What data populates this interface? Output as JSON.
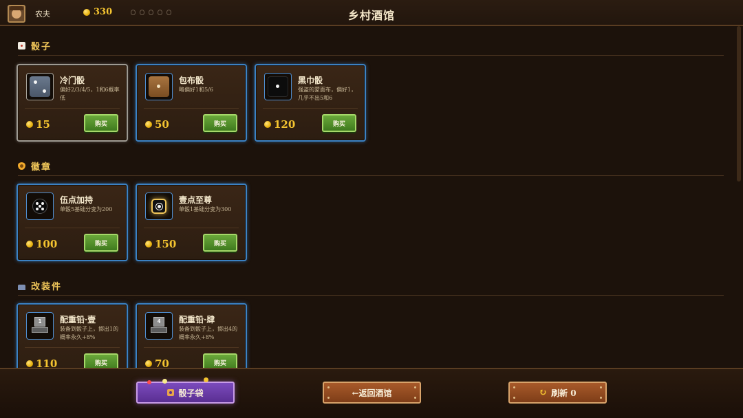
{
  "header": {
    "player_name": "农夫",
    "coins": "330",
    "lives": 5,
    "title": "乡村酒馆"
  },
  "sections": [
    {
      "title": "骰子",
      "icon": "dice-icon",
      "items": [
        {
          "name": "冷门骰",
          "desc": "偏好2/3/4/5，1和6概率低",
          "price": "15",
          "buy": "购买",
          "rarity": "common",
          "icon": "gray-die-icon"
        },
        {
          "name": "包布骰",
          "desc": "略偏好1和5/6",
          "price": "50",
          "buy": "购买",
          "rarity": "rare",
          "icon": "brown-die-icon"
        },
        {
          "name": "黑巾骰",
          "desc": "强盗的蒙面布，偏好1，几乎不出5和6",
          "price": "120",
          "buy": "购买",
          "rarity": "rare",
          "icon": "black-die-icon"
        }
      ]
    },
    {
      "title": "徽章",
      "icon": "badge-icon",
      "items": [
        {
          "name": "伍点加持",
          "desc": "单骰5基础分变为200",
          "price": "100",
          "buy": "购买",
          "rarity": "rare",
          "icon": "five-pip-icon"
        },
        {
          "name": "壹点至尊",
          "desc": "单骰1基础分变为300",
          "price": "150",
          "buy": "购买",
          "rarity": "rare",
          "icon": "one-pip-icon"
        }
      ]
    },
    {
      "title": "改装件",
      "icon": "mod-icon",
      "items": [
        {
          "name": "配重铅·壹",
          "desc": "装备到骰子上，掷出1的概率永久+8%",
          "price": "110",
          "buy": "购买",
          "rarity": "rare",
          "icon": "weight-1-icon",
          "weight_label": "1"
        },
        {
          "name": "配重铅·肆",
          "desc": "装备到骰子上，掷出4的概率永久+8%",
          "price": "70",
          "buy": "购买",
          "rarity": "rare",
          "icon": "weight-4-icon",
          "weight_label": "4"
        }
      ]
    }
  ],
  "footer": {
    "bag_label": "骰子袋",
    "back_label": "←返回酒馆",
    "refresh_label": "刷新 0"
  },
  "colors": {
    "background": "#1c120b",
    "gold": "#f4c430",
    "rare_border": "#3b82c4",
    "common_border": "#9e9a92",
    "buy_button": "#4f8f2a",
    "bag_button": "#6a3da8",
    "action_button": "#944a22"
  }
}
